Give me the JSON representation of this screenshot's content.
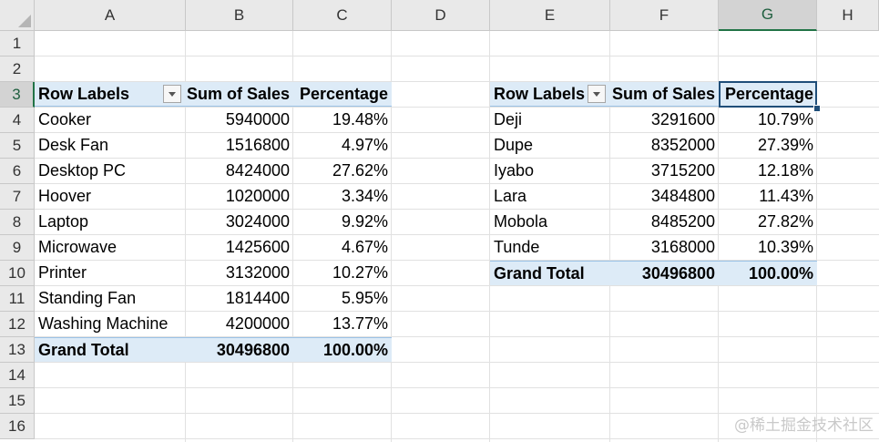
{
  "columns": [
    "A",
    "B",
    "C",
    "D",
    "E",
    "F",
    "G",
    "H"
  ],
  "rows": [
    "1",
    "2",
    "3",
    "4",
    "5",
    "6",
    "7",
    "8",
    "9",
    "10",
    "11",
    "12",
    "13",
    "14",
    "15",
    "16"
  ],
  "selected": {
    "column": "G",
    "row": "3"
  },
  "pivot_product": {
    "headers": [
      "Row Labels",
      "Sum of Sales",
      "Percentage"
    ],
    "rows": [
      [
        "Cooker",
        "5940000",
        "19.48%"
      ],
      [
        "Desk Fan",
        "1516800",
        "4.97%"
      ],
      [
        "Desktop PC",
        "8424000",
        "27.62%"
      ],
      [
        "Hoover",
        "1020000",
        "3.34%"
      ],
      [
        "Laptop",
        "3024000",
        "9.92%"
      ],
      [
        "Microwave",
        "1425600",
        "4.67%"
      ],
      [
        "Printer",
        "3132000",
        "10.27%"
      ],
      [
        "Standing Fan",
        "1814400",
        "5.95%"
      ],
      [
        "Washing Machine",
        "4200000",
        "13.77%"
      ]
    ],
    "total": [
      "Grand Total",
      "30496800",
      "100.00%"
    ]
  },
  "pivot_person": {
    "headers": [
      "Row Labels",
      "Sum of Sales",
      "Percentage"
    ],
    "rows": [
      [
        "Deji",
        "3291600",
        "10.79%"
      ],
      [
        "Dupe",
        "8352000",
        "27.39%"
      ],
      [
        "Iyabo",
        "3715200",
        "12.18%"
      ],
      [
        "Lara",
        "3484800",
        "11.43%"
      ],
      [
        "Mobola",
        "8485200",
        "27.82%"
      ],
      [
        "Tunde",
        "3168000",
        "10.39%"
      ]
    ],
    "total": [
      "Grand Total",
      "30496800",
      "100.00%"
    ]
  },
  "watermark": "@稀土掘金技术社区"
}
